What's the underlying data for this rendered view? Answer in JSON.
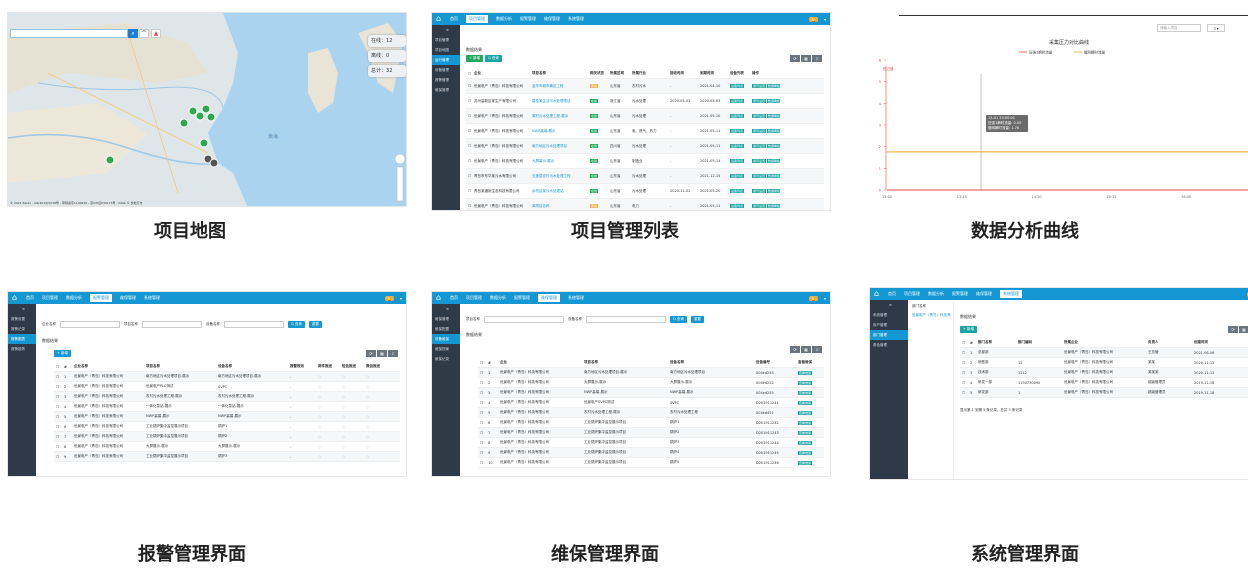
{
  "captions": [
    "项目地图",
    "项目管理列表",
    "数据分析曲线",
    "报警管理界面",
    "维保管理界面",
    "系统管理界面"
  ],
  "topnav": [
    "首页",
    "项目管理",
    "数据分析",
    "报警管理",
    "维保管理",
    "系统管理"
  ],
  "map": {
    "stats": [
      {
        "label": "在线：",
        "value": "12"
      },
      {
        "label": "离线：",
        "value": "0"
      },
      {
        "label": "总计：",
        "value": "32"
      }
    ],
    "sea_label": "黄海",
    "footer": "© 2021 Baidu - GS(2019)5218号 - 甲测资字1100930 - 京ICP证030173号 - Data © 长地万方"
  },
  "list": {
    "sidebar": [
      "项目管理",
      "项目地图",
      "运行管理",
      "设备管理",
      "报警管理",
      "维保管理"
    ],
    "buttons": {
      "add": "+ 新增",
      "query": "Q 查询"
    },
    "section": "数据结果",
    "headers": [
      "企业",
      "项目名称",
      "网关状态",
      "所属区域",
      "所属行业",
      "接收时间",
      "到期时间",
      "设备列表",
      "操作"
    ],
    "rows": [
      [
        "优景电产（青岛）科技有限公司",
        "金华市城市黄区工程",
        "离线",
        "山东省",
        "农村污水",
        "-",
        "2021-04-10"
      ],
      [
        "苏州高新区某生产有限公司",
        "碧桂某生活污水处理项目",
        "在线",
        "浙江省",
        "污水处理",
        "2020-05-01",
        "2020-05-03"
      ],
      [
        "优景电产（青岛）科技有限公司",
        "某村污水处理工程-展示",
        "在线",
        "山东省",
        "污水处理",
        "-",
        "2021-05-10"
      ],
      [
        "优景电产（青岛）科技有限公司",
        "NWP高端-展示",
        "在线",
        "山东省",
        "电、燃气、热力",
        "-",
        "2021-05-11"
      ],
      [
        "优景电产（青岛）科技有限公司",
        "南方地区污水处理项目",
        "在线",
        "四川省",
        "污水处理",
        "-",
        "2021-05-11"
      ],
      [
        "优景电产（青岛）科技有限公司",
        "大屏幕示-展示",
        "在线",
        "山东省",
        "制造业",
        "-",
        "2021-05-11"
      ],
      [
        "青岛市东华某污水有限公司",
        "五莲县农村污水处理工程",
        "在线",
        "山东省",
        "污水处理",
        "-",
        "2021-12-15"
      ],
      [
        "青岛某通用生态科技有限公司",
        "余杭区某污水处理站",
        "在线",
        "山东省",
        "污水处理",
        "2020-11-02",
        "2021-05-20"
      ],
      [
        "优景电产（青岛）科技有限公司",
        "某项目名称",
        "离线",
        "山东省",
        "电力",
        "-",
        "2021-05-11"
      ]
    ],
    "ops": [
      "设备列表",
      "通讯设置",
      "数据看板",
      "编辑",
      "删除"
    ]
  },
  "chart": {
    "search_placeholder": "请输入项目",
    "title": "采集压力对比曲线",
    "legend": [
      "压强1瞬时流量",
      "管网瞬时流量"
    ],
    "ylabel": "压力值",
    "tooltip": [
      "13-01 23:00:01",
      "压强1瞬时流量: 0.00",
      "管网瞬时流量: 1.76"
    ],
    "x_ticks": [
      "13:00",
      "13:45",
      "14:30",
      "15:15",
      "16:00",
      "16:45"
    ]
  },
  "chart_data": {
    "type": "line",
    "title": "采集压力对比曲线",
    "x": [
      "13:00",
      "13:45",
      "14:30",
      "15:15",
      "16:00",
      "16:45"
    ],
    "series": [
      {
        "name": "压强1瞬时流量",
        "values": [
          0,
          0,
          0,
          0,
          0,
          0
        ]
      },
      {
        "name": "管网瞬时流量",
        "values": [
          1.76,
          1.76,
          1.76,
          1.76,
          1.76,
          1.76
        ]
      }
    ],
    "ylim": [
      0,
      6
    ],
    "ylabel": "压力值"
  },
  "alarm": {
    "sidebar": [
      "报警设置",
      "报警记录",
      "报警图表",
      "报警趋势"
    ],
    "filters": [
      "企业名称",
      "项目名称",
      "设备名称"
    ],
    "buttons": {
      "query": "Q 查询",
      "reset": "重置",
      "add": "+ 新增"
    },
    "section": "数据结果",
    "headers": [
      "#",
      "企业名称",
      "项目名称",
      "设备名称",
      "报警规则",
      "邮件推送",
      "短信推送",
      "微信推送"
    ],
    "rows": [
      [
        "1",
        "优景电产（青岛）科技有限公司",
        "南方地区污水处理项目-展示",
        "南方地区污水处理项目-展示"
      ],
      [
        "2",
        "优景电产（青岛）科技有限公司",
        "优景电产PLC测试",
        "SVPC"
      ],
      [
        "3",
        "优景电产（青岛）科技有限公司",
        "农村污水处理工程-展示",
        "农村污水处理工程-展示"
      ],
      [
        "4",
        "优景电产（青岛）科技有限公司",
        "一体化泵站-展示",
        "一体化泵站-展示"
      ],
      [
        "5",
        "优景电产（青岛）科技有限公司",
        "NWP高端-展示",
        "NWP高端-展示"
      ],
      [
        "6",
        "优景电产（青岛）科技有限公司",
        "工业锅炉集中监控展示项目",
        "锅炉1"
      ],
      [
        "7",
        "优景电产（青岛）科技有限公司",
        "工业锅炉集中监控展示项目",
        "锅炉2"
      ],
      [
        "8",
        "优景电产（青岛）科技有限公司",
        "大屏展示-展示",
        "大屏展示-展示"
      ],
      [
        "9",
        "优景电产（青岛）科技有限公司",
        "工业锅炉集中监控展示项目",
        "锅炉3"
      ]
    ]
  },
  "maint": {
    "sidebar": [
      "维保管理",
      "维保配置",
      "设备维保",
      "维保档案",
      "维保记录"
    ],
    "filters": [
      "项目名称",
      "设备名称"
    ],
    "buttons": {
      "query": "Q 查询",
      "reset": "重置"
    },
    "section": "数据结果",
    "headers": [
      "#",
      "企业",
      "项目名称",
      "设备名称",
      "设备编号",
      "查看维保"
    ],
    "rows": [
      [
        "1",
        "优景电产（青岛）科技有限公司",
        "南方地区污水处理项目-展示",
        "南方地区污水处理项目",
        "004ed245"
      ],
      [
        "2",
        "优景电产（青岛）科技有限公司",
        "大屏展示-展示",
        "大屏展示-展示",
        "004ed222"
      ],
      [
        "3",
        "优景电产（青岛）科技有限公司",
        "NWP高端-展示",
        "NWP高端-展示",
        "004ed255"
      ],
      [
        "4",
        "优景电产（青岛）科技有限公司",
        "优景电产SVPC测试",
        "SVPC",
        "D201911241"
      ],
      [
        "5",
        "优景电产（青岛）科技有限公司",
        "农村污水处理工程-展示",
        "农村污水处理工程",
        "004ed451"
      ],
      [
        "6",
        "优景电产（青岛）科技有限公司",
        "工业锅炉集中监控展示项目",
        "锅炉1",
        "D201911242"
      ],
      [
        "7",
        "优景电产（青岛）科技有限公司",
        "工业锅炉集中监控展示项目",
        "锅炉2",
        "D201911243"
      ],
      [
        "8",
        "优景电产（青岛）科技有限公司",
        "工业锅炉集中监控展示项目",
        "锅炉3",
        "D201911244"
      ],
      [
        "9",
        "优景电产（青岛）科技有限公司",
        "工业锅炉集中监控展示项目",
        "锅炉4",
        "D201911245"
      ],
      [
        "10",
        "优景电产（青岛）科技有限公司",
        "工业锅炉集中监控展示项目",
        "锅炉5",
        "D201911246"
      ]
    ],
    "op": "查看维保"
  },
  "sys": {
    "sidebar": [
      "系统管理",
      "用户管理",
      "部门管理",
      "角色管理"
    ],
    "tree_title": "部门名称",
    "tree_node": "优景电产（青岛）科技有限公司",
    "section": "数据结果",
    "buttons": {
      "add": "+ 新增"
    },
    "headers": [
      "#",
      "部门名称",
      "部门编码",
      "所属企业",
      "负责人",
      "创建时间"
    ],
    "rows": [
      [
        "1",
        "总部部",
        "",
        "优景电产（青岛）科技有限公司",
        "王总管",
        "2021-06-06"
      ],
      [
        "2",
        "销售部",
        "12",
        "优景电产（青岛）科技有限公司",
        "某某",
        "2020-11-12"
      ],
      [
        "3",
        "技术部",
        "1212",
        "优景电产（青岛）科技有限公司",
        "某某某",
        "2020-11-12"
      ],
      [
        "4",
        "研发一部",
        "1150730090",
        "优景电产（青岛）科技有限公司",
        "超级管理员",
        "2019-11-18"
      ],
      [
        "5",
        "研发部",
        "1",
        "优景电产（青岛）科技有限公司",
        "超级管理员",
        "2019-11-18"
      ]
    ],
    "pager": "显示第 1 到第 5 条记录，总共 5 条记录"
  }
}
